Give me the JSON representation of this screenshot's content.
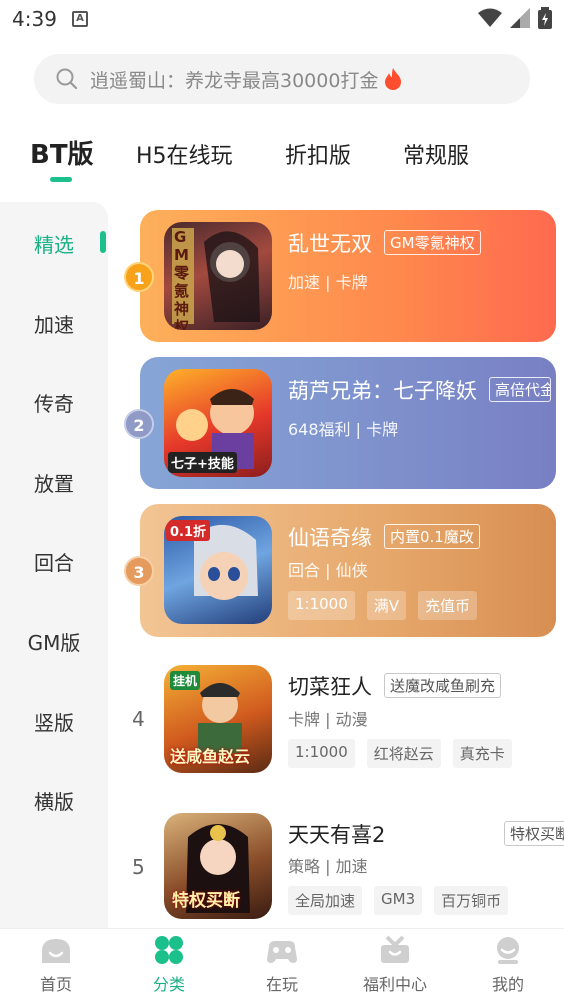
{
  "status": {
    "time": "4:39",
    "sim_letter": "A"
  },
  "search": {
    "placeholder": "逍遥蜀山：养龙寺最高30000打金"
  },
  "tabs": [
    {
      "label": "BT版"
    },
    {
      "label": "H5在线玩"
    },
    {
      "label": "折扣版"
    },
    {
      "label": "常规服"
    }
  ],
  "sidebar": {
    "items": [
      {
        "label": "精选"
      },
      {
        "label": "加速"
      },
      {
        "label": "传奇"
      },
      {
        "label": "放置"
      },
      {
        "label": "回合"
      },
      {
        "label": "GM版"
      },
      {
        "label": "竖版"
      },
      {
        "label": "横版"
      }
    ]
  },
  "games": [
    {
      "rank": "1",
      "name": "乱世无双",
      "badge": "GM零氪神权",
      "categories": "加速 | 卡牌",
      "tags": [],
      "icon_text": "GM零氪神权"
    },
    {
      "rank": "2",
      "name": "葫芦兄弟：七子降妖",
      "badge": "高倍代金",
      "categories": "648福利 | 卡牌",
      "tags": [],
      "icon_text": "七子+技能"
    },
    {
      "rank": "3",
      "name": "仙语奇缘",
      "badge": "内置0.1魔改",
      "categories": "回合 | 仙侠",
      "tags": [
        "1:1000",
        "满V",
        "充值币"
      ],
      "icon_text": "0.1折"
    },
    {
      "rank": "4",
      "name": "切菜狂人",
      "badge": "送魔改咸鱼刷充",
      "categories": "卡牌 | 动漫",
      "tags": [
        "1:1000",
        "红将赵云",
        "真充卡"
      ],
      "icon_text": "送咸鱼赵云"
    },
    {
      "rank": "5",
      "name": "天天有喜2",
      "badge": "特权买断",
      "categories": "策略 | 加速",
      "tags": [
        "全局加速",
        "GM3",
        "百万铜币"
      ],
      "icon_text": "特权买断"
    }
  ],
  "bottom_nav": [
    {
      "label": "首页"
    },
    {
      "label": "分类"
    },
    {
      "label": "在玩"
    },
    {
      "label": "福利中心"
    },
    {
      "label": "我的"
    }
  ],
  "colors": {
    "accent": "#1bc08a",
    "card1": "#ff8a4d",
    "card2": "#7e90cc",
    "card3": "#e6a76a"
  }
}
